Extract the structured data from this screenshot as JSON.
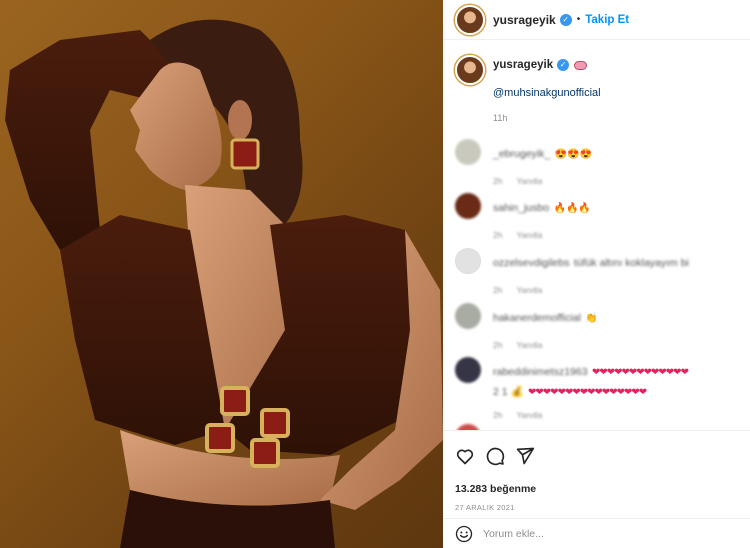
{
  "post": {
    "username": "yusrageyik",
    "follow_label": "Takip Et",
    "caption_mention": "@muhsinakgunofficial",
    "caption_time": "11h",
    "likes": "13.283 beğenme",
    "date": "27 ARALIK 2021",
    "comment_placeholder": "Yorum ekle..."
  },
  "comments": [
    {
      "user": "_ebrugeyik_",
      "text": "",
      "emoji": "😍😍😍",
      "meta": [
        "2h",
        "Yanıtla"
      ],
      "avatar_color": "#c9c9bd"
    },
    {
      "user": "sahin_jusbo",
      "text": "",
      "emoji": "🔥🔥🔥",
      "meta": [
        "2h",
        "Yanıtla"
      ],
      "avatar_color": "#6a2a16"
    },
    {
      "user": "ozzelsevdigilebs",
      "text": "tüfük altını koklayayım bi",
      "emoji": "",
      "meta": [
        "2h",
        "Yanıtla"
      ],
      "avatar_color": "#e2e2e2"
    },
    {
      "user": "hakanerdemofficial",
      "text": "",
      "emoji": "👏",
      "meta": [
        "2h",
        "Yanıtla"
      ],
      "avatar_color": "#a9aca2"
    },
    {
      "user": "rabeddinimetsz1963",
      "text": "2 1 💰",
      "emoji": "",
      "meta": [
        "2h",
        "Yanıtla"
      ],
      "avatar_color": "#353545"
    },
    {
      "user": "",
      "text": "",
      "emoji": "",
      "meta": [],
      "avatar_color": "#d24a4a"
    }
  ],
  "colors": {
    "accent": "#0095f6",
    "verified": "#3897f0",
    "mention": "#00376b",
    "hearts": "#e0245e"
  },
  "icons": [
    "heart-icon",
    "comment-icon",
    "share-icon",
    "emoji-icon",
    "verified-icon",
    "brain-emoji-icon"
  ]
}
